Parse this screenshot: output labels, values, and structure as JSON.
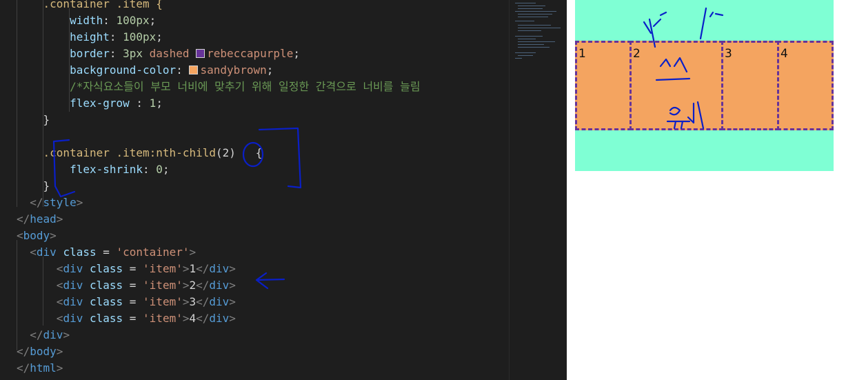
{
  "editor": {
    "lines": [
      {
        "name": "code-line-selector-item",
        "tokens": [
          {
            "t": "    .container .item {",
            "c": "sel"
          }
        ]
      },
      {
        "name": "code-line-width",
        "tokens": [
          {
            "t": "        width",
            "c": "prop"
          },
          {
            "t": ": ",
            "c": "pun"
          },
          {
            "t": "100px",
            "c": "num"
          },
          {
            "t": ";",
            "c": "pun"
          }
        ]
      },
      {
        "name": "code-line-height",
        "tokens": [
          {
            "t": "        height",
            "c": "prop"
          },
          {
            "t": ": ",
            "c": "pun"
          },
          {
            "t": "100px",
            "c": "num"
          },
          {
            "t": ";",
            "c": "pun"
          }
        ]
      },
      {
        "name": "code-line-border",
        "tokens": [
          {
            "t": "        border",
            "c": "prop"
          },
          {
            "t": ": ",
            "c": "pun"
          },
          {
            "t": "3px",
            "c": "num"
          },
          {
            "t": " dashed ",
            "c": "val"
          },
          {
            "swatch": "#663399"
          },
          {
            "t": "rebeccapurple",
            "c": "val"
          },
          {
            "t": ";",
            "c": "pun"
          }
        ]
      },
      {
        "name": "code-line-background",
        "tokens": [
          {
            "t": "        background-color",
            "c": "prop"
          },
          {
            "t": ": ",
            "c": "pun"
          },
          {
            "swatch": "#f4a460"
          },
          {
            "t": "sandybrown",
            "c": "val"
          },
          {
            "t": ";",
            "c": "pun"
          }
        ]
      },
      {
        "name": "code-line-comment",
        "tokens": [
          {
            "t": "        /*자식요소들이 부모 너비에 맞추기 위해 일정한 간격으로 너비를 늘림",
            "c": "com"
          }
        ]
      },
      {
        "name": "code-line-flex-grow",
        "tokens": [
          {
            "t": "        flex-grow",
            "c": "prop"
          },
          {
            "t": " : ",
            "c": "pun"
          },
          {
            "t": "1",
            "c": "num"
          },
          {
            "t": ";",
            "c": "pun"
          }
        ]
      },
      {
        "name": "code-line-close-brace",
        "tokens": [
          {
            "t": "    }",
            "c": "pun"
          }
        ]
      },
      {
        "name": "code-line-blank",
        "tokens": []
      },
      {
        "name": "code-line-nth-child",
        "tokens": [
          {
            "t": "    .container .item:nth-child",
            "c": "sel"
          },
          {
            "t": "(2)   {",
            "c": "pun"
          }
        ]
      },
      {
        "name": "code-line-flex-shrink",
        "tokens": [
          {
            "t": "        flex-shrink",
            "c": "prop"
          },
          {
            "t": ": ",
            "c": "pun"
          },
          {
            "t": "0",
            "c": "num"
          },
          {
            "t": ";",
            "c": "pun"
          }
        ]
      },
      {
        "name": "code-line-close-brace-2",
        "tokens": [
          {
            "t": "    }",
            "c": "pun"
          }
        ]
      },
      {
        "name": "code-line-style-close",
        "tokens": [
          {
            "t": "  ",
            "c": "txt"
          },
          {
            "t": "</",
            "c": "br"
          },
          {
            "t": "style",
            "c": "tag"
          },
          {
            "t": ">",
            "c": "br"
          }
        ]
      },
      {
        "name": "code-line-head-close",
        "tokens": [
          {
            "t": "</",
            "c": "br"
          },
          {
            "t": "head",
            "c": "tag"
          },
          {
            "t": ">",
            "c": "br"
          }
        ]
      },
      {
        "name": "code-line-body-open",
        "tokens": [
          {
            "t": "<",
            "c": "br"
          },
          {
            "t": "body",
            "c": "tag"
          },
          {
            "t": ">",
            "c": "br"
          }
        ]
      },
      {
        "name": "code-line-div-container",
        "tokens": [
          {
            "t": "  ",
            "c": "txt"
          },
          {
            "t": "<",
            "c": "br"
          },
          {
            "t": "div",
            "c": "tag"
          },
          {
            "t": " class",
            "c": "attr"
          },
          {
            "t": " = ",
            "c": "pun"
          },
          {
            "t": "'container'",
            "c": "str"
          },
          {
            "t": ">",
            "c": "br"
          }
        ]
      },
      {
        "name": "code-line-div-item-1",
        "tokens": [
          {
            "t": "      ",
            "c": "txt"
          },
          {
            "t": "<",
            "c": "br"
          },
          {
            "t": "div",
            "c": "tag"
          },
          {
            "t": " class",
            "c": "attr"
          },
          {
            "t": " = ",
            "c": "pun"
          },
          {
            "t": "'item'",
            "c": "str"
          },
          {
            "t": ">",
            "c": "br"
          },
          {
            "t": "1",
            "c": "txt"
          },
          {
            "t": "</",
            "c": "br"
          },
          {
            "t": "div",
            "c": "tag"
          },
          {
            "t": ">",
            "c": "br"
          }
        ]
      },
      {
        "name": "code-line-div-item-2",
        "tokens": [
          {
            "t": "      ",
            "c": "txt"
          },
          {
            "t": "<",
            "c": "br"
          },
          {
            "t": "div",
            "c": "tag"
          },
          {
            "t": " class",
            "c": "attr"
          },
          {
            "t": " = ",
            "c": "pun"
          },
          {
            "t": "'item'",
            "c": "str"
          },
          {
            "t": ">",
            "c": "br"
          },
          {
            "t": "2",
            "c": "txt"
          },
          {
            "t": "</",
            "c": "br"
          },
          {
            "t": "div",
            "c": "tag"
          },
          {
            "t": ">",
            "c": "br"
          }
        ]
      },
      {
        "name": "code-line-div-item-3",
        "tokens": [
          {
            "t": "      ",
            "c": "txt"
          },
          {
            "t": "<",
            "c": "br"
          },
          {
            "t": "div",
            "c": "tag"
          },
          {
            "t": " class",
            "c": "attr"
          },
          {
            "t": " = ",
            "c": "pun"
          },
          {
            "t": "'item'",
            "c": "str"
          },
          {
            "t": ">",
            "c": "br"
          },
          {
            "t": "3",
            "c": "txt"
          },
          {
            "t": "</",
            "c": "br"
          },
          {
            "t": "div",
            "c": "tag"
          },
          {
            "t": ">",
            "c": "br"
          }
        ]
      },
      {
        "name": "code-line-div-item-4",
        "tokens": [
          {
            "t": "      ",
            "c": "txt"
          },
          {
            "t": "<",
            "c": "br"
          },
          {
            "t": "div",
            "c": "tag"
          },
          {
            "t": " class",
            "c": "attr"
          },
          {
            "t": " = ",
            "c": "pun"
          },
          {
            "t": "'item'",
            "c": "str"
          },
          {
            "t": ">",
            "c": "br"
          },
          {
            "t": "4",
            "c": "txt"
          },
          {
            "t": "</",
            "c": "br"
          },
          {
            "t": "div",
            "c": "tag"
          },
          {
            "t": ">",
            "c": "br"
          }
        ]
      },
      {
        "name": "code-line-div-close",
        "tokens": [
          {
            "t": "  ",
            "c": "txt"
          },
          {
            "t": "</",
            "c": "br"
          },
          {
            "t": "div",
            "c": "tag"
          },
          {
            "t": ">",
            "c": "br"
          }
        ]
      },
      {
        "name": "code-line-body-close",
        "tokens": [
          {
            "t": "</",
            "c": "br"
          },
          {
            "t": "body",
            "c": "tag"
          },
          {
            "t": ">",
            "c": "br"
          }
        ]
      },
      {
        "name": "code-line-html-close",
        "tokens": [
          {
            "t": "</",
            "c": "br"
          },
          {
            "t": "html",
            "c": "tag"
          },
          {
            "t": ">",
            "c": "br"
          }
        ]
      }
    ]
  },
  "preview": {
    "container_color": "#7fffd4",
    "item_color": "#f4a460",
    "border_color": "#663399",
    "items": [
      {
        "label": "1"
      },
      {
        "label": "2"
      },
      {
        "label": "3"
      },
      {
        "label": "4"
      }
    ],
    "annotation_text": "스 유지"
  },
  "ink_color": "#0a1fc8"
}
